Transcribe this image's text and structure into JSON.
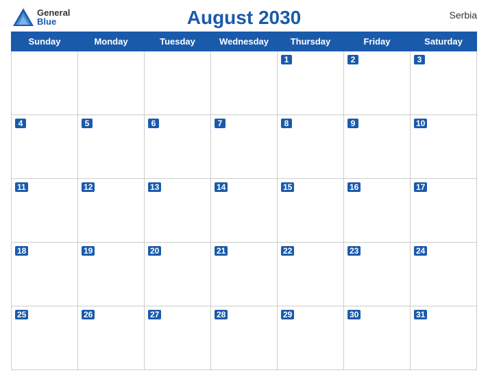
{
  "header": {
    "title": "August 2030",
    "country": "Serbia",
    "logo_general": "General",
    "logo_blue": "Blue"
  },
  "weekdays": [
    "Sunday",
    "Monday",
    "Tuesday",
    "Wednesday",
    "Thursday",
    "Friday",
    "Saturday"
  ],
  "weeks": [
    [
      null,
      null,
      null,
      null,
      1,
      2,
      3
    ],
    [
      4,
      5,
      6,
      7,
      8,
      9,
      10
    ],
    [
      11,
      12,
      13,
      14,
      15,
      16,
      17
    ],
    [
      18,
      19,
      20,
      21,
      22,
      23,
      24
    ],
    [
      25,
      26,
      27,
      28,
      29,
      30,
      31
    ]
  ],
  "colors": {
    "header_bg": "#1a5aab",
    "header_text": "#ffffff",
    "title_color": "#1a5aab"
  }
}
